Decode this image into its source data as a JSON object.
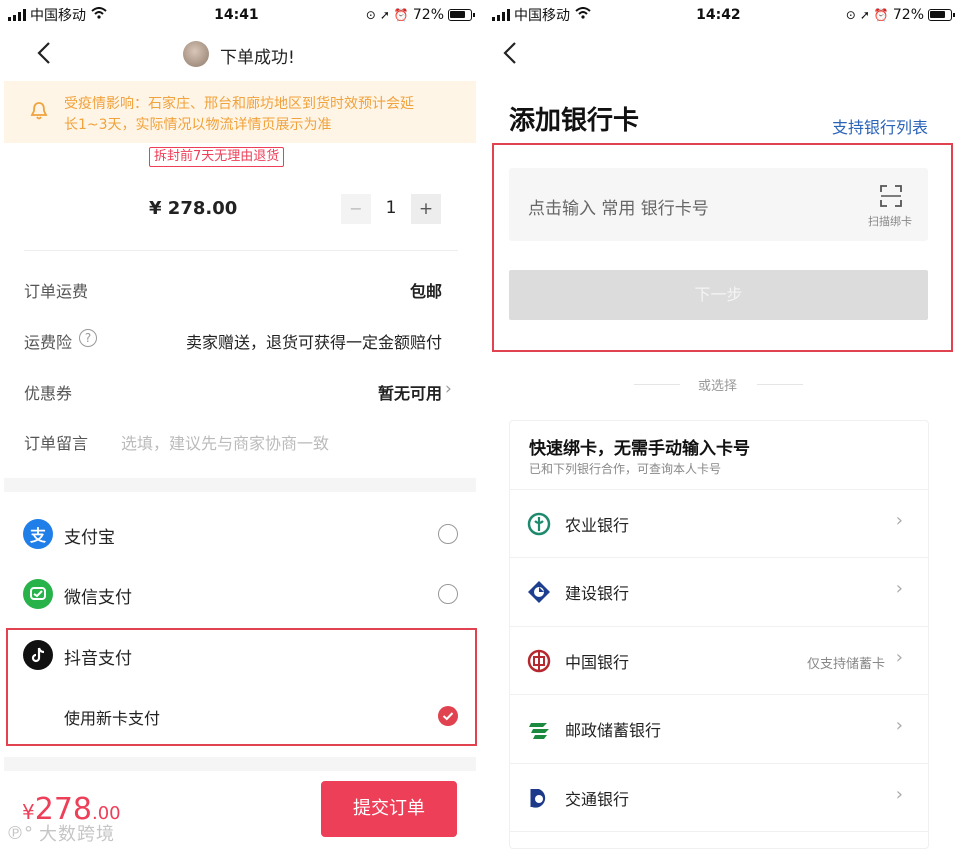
{
  "left": {
    "status": {
      "carrier": "中国移动",
      "time": "14:41",
      "battery": "72%"
    },
    "header": {
      "title": "下单成功!"
    },
    "notice": {
      "text_line1": "受疫情影响：石家庄、邢台和廊坊地区到货时效预计会延",
      "text_line2": "长1~3天，实际情况以物流详情页展示为准"
    },
    "return_tag": "拆封前7天无理由退货",
    "product": {
      "price": "¥ 278.00",
      "minus": "−",
      "qty": "1",
      "plus": "+"
    },
    "rows": [
      {
        "label": "订单运费",
        "value": "包邮"
      },
      {
        "label": "运费险",
        "value": "卖家赠送，退货可获得一定金额赔付"
      },
      {
        "label": "优惠券",
        "value": "暂无可用"
      },
      {
        "label": "订单留言",
        "value": "选填，建议先与商家协商一致"
      }
    ],
    "payments": [
      {
        "name": "支付宝",
        "icon": "支"
      },
      {
        "name": "微信支付"
      },
      {
        "name": "抖音支付"
      }
    ],
    "new_card": "使用新卡支付",
    "footer": {
      "currency": "¥",
      "amount": "278",
      "cents": ".00",
      "submit": "提交订单"
    },
    "watermark": "大数跨境",
    "colors": {
      "accent": "#ee3f58",
      "notice_bg": "#fff5e6",
      "notice_text": "#f0a23c"
    }
  },
  "right": {
    "status": {
      "carrier": "中国移动",
      "time": "14:42",
      "battery": "72%"
    },
    "title": "添加银行卡",
    "support_link": "支持银行列表",
    "card_input": {
      "placeholder": "点击输入 常用 银行卡号",
      "scan_label": "扫描绑卡"
    },
    "next_button": "下一步",
    "or_choose": "或选择",
    "quick": {
      "title": "快速绑卡，无需手动输入卡号",
      "subtitle": "已和下列银行合作，可查询本人卡号"
    },
    "banks": [
      {
        "name": "农业银行",
        "note": "",
        "icon": "abc-bank-icon",
        "color": "#1e8a6d"
      },
      {
        "name": "建设银行",
        "note": "",
        "icon": "ccb-bank-icon",
        "color": "#1d3f8f"
      },
      {
        "name": "中国银行",
        "note": "仅支持储蓄卡",
        "icon": "boc-bank-icon",
        "color": "#b6282f"
      },
      {
        "name": "邮政储蓄银行",
        "note": "",
        "icon": "psbc-bank-icon",
        "color": "#1b8a3e"
      },
      {
        "name": "交通银行",
        "note": "",
        "icon": "bocom-bank-icon",
        "color": "#1d3a8a"
      }
    ],
    "colors": {
      "link": "#2a63b7",
      "accent": "#e0434f"
    }
  }
}
